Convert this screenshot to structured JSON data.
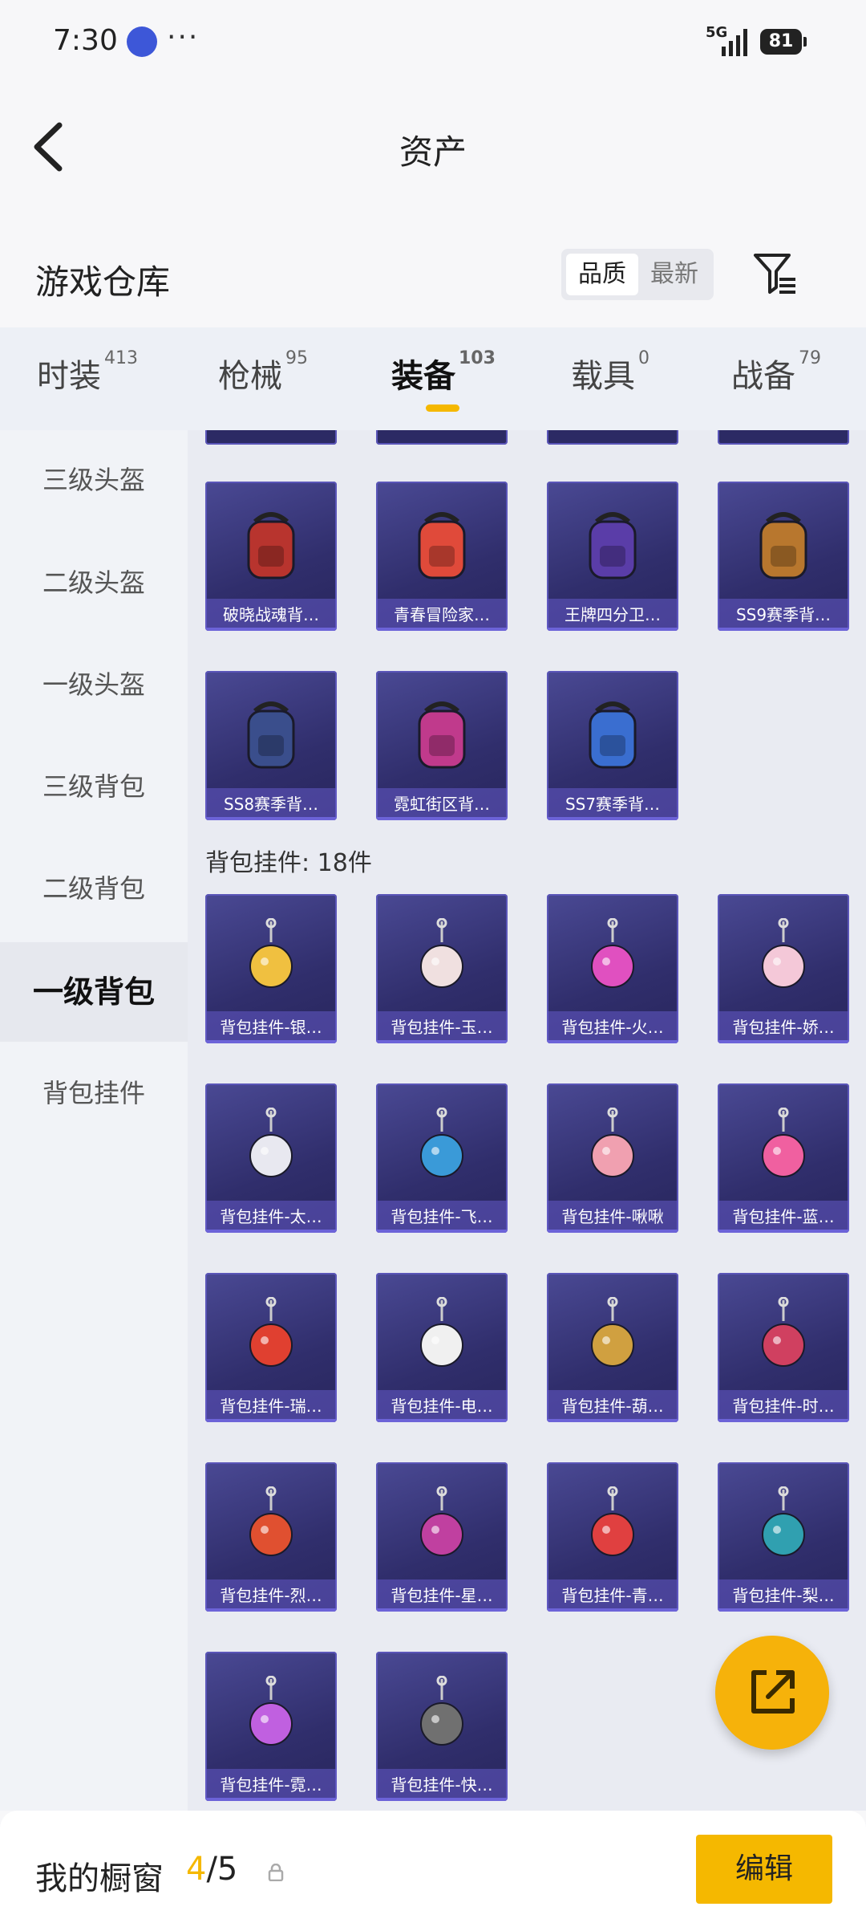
{
  "status_bar": {
    "time": "7:30",
    "dots": "···",
    "network": "5G",
    "battery": "81"
  },
  "nav": {
    "title": "资产"
  },
  "section": {
    "title": "游戏仓库",
    "sort_options": [
      "品质",
      "最新"
    ]
  },
  "category_tabs": [
    {
      "label": "时装",
      "count": "413",
      "active": false
    },
    {
      "label": "枪械",
      "count": "95",
      "active": false
    },
    {
      "label": "装备",
      "count": "103",
      "active": true
    },
    {
      "label": "载具",
      "count": "0",
      "active": false
    },
    {
      "label": "战备",
      "count": "79",
      "active": false
    }
  ],
  "sidebar": [
    {
      "label": "三级头盔",
      "active": false
    },
    {
      "label": "二级头盔",
      "active": false
    },
    {
      "label": "一级头盔",
      "active": false
    },
    {
      "label": "三级背包",
      "active": false
    },
    {
      "label": "二级背包",
      "active": false
    },
    {
      "label": "一级背包",
      "active": true
    },
    {
      "label": "背包挂件",
      "active": false
    }
  ],
  "backpacks": [
    {
      "name": "破晓战魂背…",
      "icon": "backpack-icon",
      "color": "#b8342e"
    },
    {
      "name": "青春冒险家…",
      "icon": "backpack-icon",
      "color": "#e04a3a"
    },
    {
      "name": "王牌四分卫…",
      "icon": "backpack-icon",
      "color": "#5a3da8"
    },
    {
      "name": "SS9赛季背…",
      "icon": "backpack-icon",
      "color": "#b8772e"
    },
    {
      "name": "SS8赛季背…",
      "icon": "backpack-icon",
      "color": "#3a4e8c"
    },
    {
      "name": "霓虹街区背…",
      "icon": "backpack-icon",
      "color": "#c03a8c"
    },
    {
      "name": "SS7赛季背…",
      "icon": "backpack-icon",
      "color": "#3a6ed0"
    }
  ],
  "pendant_group": {
    "title": "背包挂件: 18件"
  },
  "pendants": [
    {
      "name": "背包挂件-银…",
      "icon": "pendant-icon",
      "color": "#f0c040"
    },
    {
      "name": "背包挂件-玉…",
      "icon": "pendant-icon",
      "color": "#f0e0e0"
    },
    {
      "name": "背包挂件-火…",
      "icon": "pendant-icon",
      "color": "#e050c0"
    },
    {
      "name": "背包挂件-娇…",
      "icon": "pendant-icon",
      "color": "#f4c8d8"
    },
    {
      "name": "背包挂件-太…",
      "icon": "pendant-icon",
      "color": "#e8e8f0"
    },
    {
      "name": "背包挂件-飞…",
      "icon": "pendant-icon",
      "color": "#3a9ad8"
    },
    {
      "name": "背包挂件-啾啾",
      "icon": "pendant-icon",
      "color": "#f0a0b0"
    },
    {
      "name": "背包挂件-蓝…",
      "icon": "pendant-icon",
      "color": "#f060a0"
    },
    {
      "name": "背包挂件-瑞…",
      "icon": "pendant-icon",
      "color": "#e04030"
    },
    {
      "name": "背包挂件-电…",
      "icon": "pendant-icon",
      "color": "#f0f0f0"
    },
    {
      "name": "背包挂件-葫…",
      "icon": "pendant-icon",
      "color": "#d0a040"
    },
    {
      "name": "背包挂件-时…",
      "icon": "pendant-icon",
      "color": "#d04060"
    },
    {
      "name": "背包挂件-烈…",
      "icon": "pendant-icon",
      "color": "#e05030"
    },
    {
      "name": "背包挂件-星…",
      "icon": "pendant-icon",
      "color": "#c040a0"
    },
    {
      "name": "背包挂件-青…",
      "icon": "pendant-icon",
      "color": "#e04040"
    },
    {
      "name": "背包挂件-梨…",
      "icon": "pendant-icon",
      "color": "#30a0b0"
    },
    {
      "name": "背包挂件-霓…",
      "icon": "pendant-icon",
      "color": "#c060e0"
    },
    {
      "name": "背包挂件-快…",
      "icon": "pendant-icon",
      "color": "#707070"
    }
  ],
  "bottom_bar": {
    "label": "我的橱窗",
    "current": "4",
    "total": "/5",
    "edit_label": "编辑"
  },
  "colors": {
    "accent": "#f5b800",
    "card_bg": "#302e6c"
  }
}
